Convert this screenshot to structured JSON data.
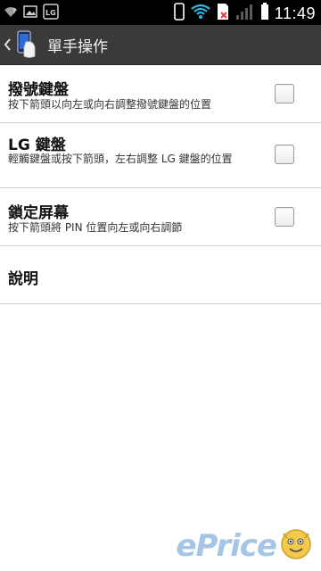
{
  "status_bar": {
    "time": "11:49",
    "left_icons": [
      "wifi-question-icon",
      "image-icon",
      "lg-icon"
    ],
    "right_icons": [
      "phone-icon",
      "wifi-icon",
      "sim-error-icon",
      "signal-icon",
      "battery-icon"
    ]
  },
  "action_bar": {
    "title": "單手操作",
    "back_icon": "chevron-left-icon",
    "app_icon": "one-hand-phone-icon"
  },
  "settings": {
    "items": [
      {
        "title": "撥號鍵盤",
        "summary": "按下箭頭以向左或向右調整撥號鍵盤的位置",
        "checked": false
      },
      {
        "title": "LG 鍵盤",
        "summary": "輕觸鍵盤或按下箭頭，左右調整 LG 鍵盤的位置",
        "checked": false
      },
      {
        "title": "鎖定屏幕",
        "summary": "按下箭頭將 PIN 位置向左或向右調節",
        "checked": false
      },
      {
        "title": "說明"
      }
    ]
  },
  "watermark": {
    "text": "ePrice"
  },
  "colors": {
    "status_bar_bg": "#000000",
    "action_bar_bg": "#3a3a3a",
    "divider": "#cfcfcf",
    "wifi_accent": "#33b5e5",
    "sim_error": "#e53935"
  }
}
